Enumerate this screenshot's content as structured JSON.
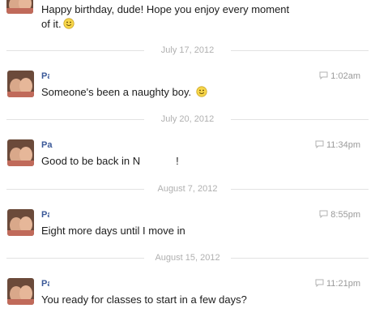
{
  "top_message": {
    "text": "Happy birthday, dude! Hope you enjoy every moment\nof it.",
    "emoji": "smiley-emoticon"
  },
  "dividers": [
    {
      "label": "July 17, 2012"
    },
    {
      "label": "July 20, 2012"
    },
    {
      "label": "August 7, 2012"
    },
    {
      "label": "August 15, 2012"
    }
  ],
  "messages": [
    {
      "sender": "Pa",
      "time": "1:02am",
      "text": "Someone's been a naughty boy.",
      "emoji": "smiley-emoticon"
    },
    {
      "sender": "Pa",
      "time": "11:34pm",
      "text_before": "Good to be back in N",
      "text_after": "!"
    },
    {
      "sender": "Pa",
      "time": "8:55pm",
      "text": "Eight more days until I move in"
    },
    {
      "sender": "Pa",
      "time": "11:21pm",
      "text": "You ready for classes to start in a few days?"
    }
  ],
  "icons": {
    "reply": "speech-bubble-icon",
    "avatar": "profile-photo"
  },
  "colors": {
    "sender_link": "#3b5998",
    "divider_text": "#b0b0b0",
    "timestamp": "#9a9a9a",
    "body_text": "#1d1d1d"
  }
}
